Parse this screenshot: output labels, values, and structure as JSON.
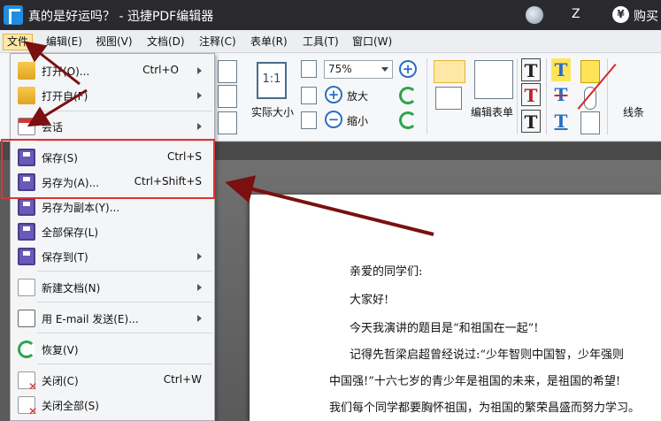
{
  "titlebar": {
    "title": "真的是好运吗？ - 迅捷PDF编辑器",
    "user": "Z",
    "buy_icon": "¥",
    "buy_label": "购买"
  },
  "menubar": {
    "items": [
      {
        "label": "文件"
      },
      {
        "label": "编辑(E)"
      },
      {
        "label": "视图(V)"
      },
      {
        "label": "文档(D)"
      },
      {
        "label": "注释(C)"
      },
      {
        "label": "表单(R)"
      },
      {
        "label": "工具(T)"
      },
      {
        "label": "窗口(W)"
      }
    ]
  },
  "toolbar": {
    "zoom_value": "75%",
    "zoom_in_label": "放大",
    "zoom_out_label": "缩小",
    "actual_size_box": "1:1",
    "actual_size_label": "实际大小",
    "edit_form_label": "编辑表单",
    "line_label": "线条"
  },
  "file_menu": {
    "items": [
      {
        "label": "打开(O)...",
        "shortcut": "Ctrl+O",
        "submenu": true
      },
      {
        "label": "打开自(F)",
        "shortcut": "",
        "submenu": true
      },
      {
        "label": "会话",
        "shortcut": "",
        "submenu": true
      },
      {
        "label": "保存(S)",
        "shortcut": "Ctrl+S",
        "submenu": false
      },
      {
        "label": "另存为(A)...",
        "shortcut": "Ctrl+Shift+S",
        "submenu": false
      },
      {
        "label": "另存为副本(Y)...",
        "shortcut": "",
        "submenu": false
      },
      {
        "label": "全部保存(L)",
        "shortcut": "",
        "submenu": false
      },
      {
        "label": "保存到(T)",
        "shortcut": "",
        "submenu": true
      },
      {
        "label": "新建文档(N)",
        "shortcut": "",
        "submenu": true
      },
      {
        "label": "用 E-mail 发送(E)...",
        "shortcut": "",
        "submenu": true
      },
      {
        "label": "恢复(V)",
        "shortcut": "",
        "submenu": false
      },
      {
        "label": "关闭(C)",
        "shortcut": "Ctrl+W",
        "submenu": false
      },
      {
        "label": "关闭全部(S)",
        "shortcut": "",
        "submenu": false
      }
    ]
  },
  "document": {
    "lines": [
      "亲爱的同学们:",
      "大家好!",
      "今天我演讲的题目是“和祖国在一起”!",
      "记得先哲梁启超曾经说过:“少年智则中国智，少年强则",
      "中国强!”十六七岁的青少年是祖国的未来，是祖国的希望!",
      "我们每个同学都要胸怀祖国，为祖国的繁荣昌盛而努力学习。"
    ]
  },
  "colors": {
    "titlebar": "#2a2a2e",
    "highlight": "#e03434",
    "arrow": "#7a1010"
  }
}
